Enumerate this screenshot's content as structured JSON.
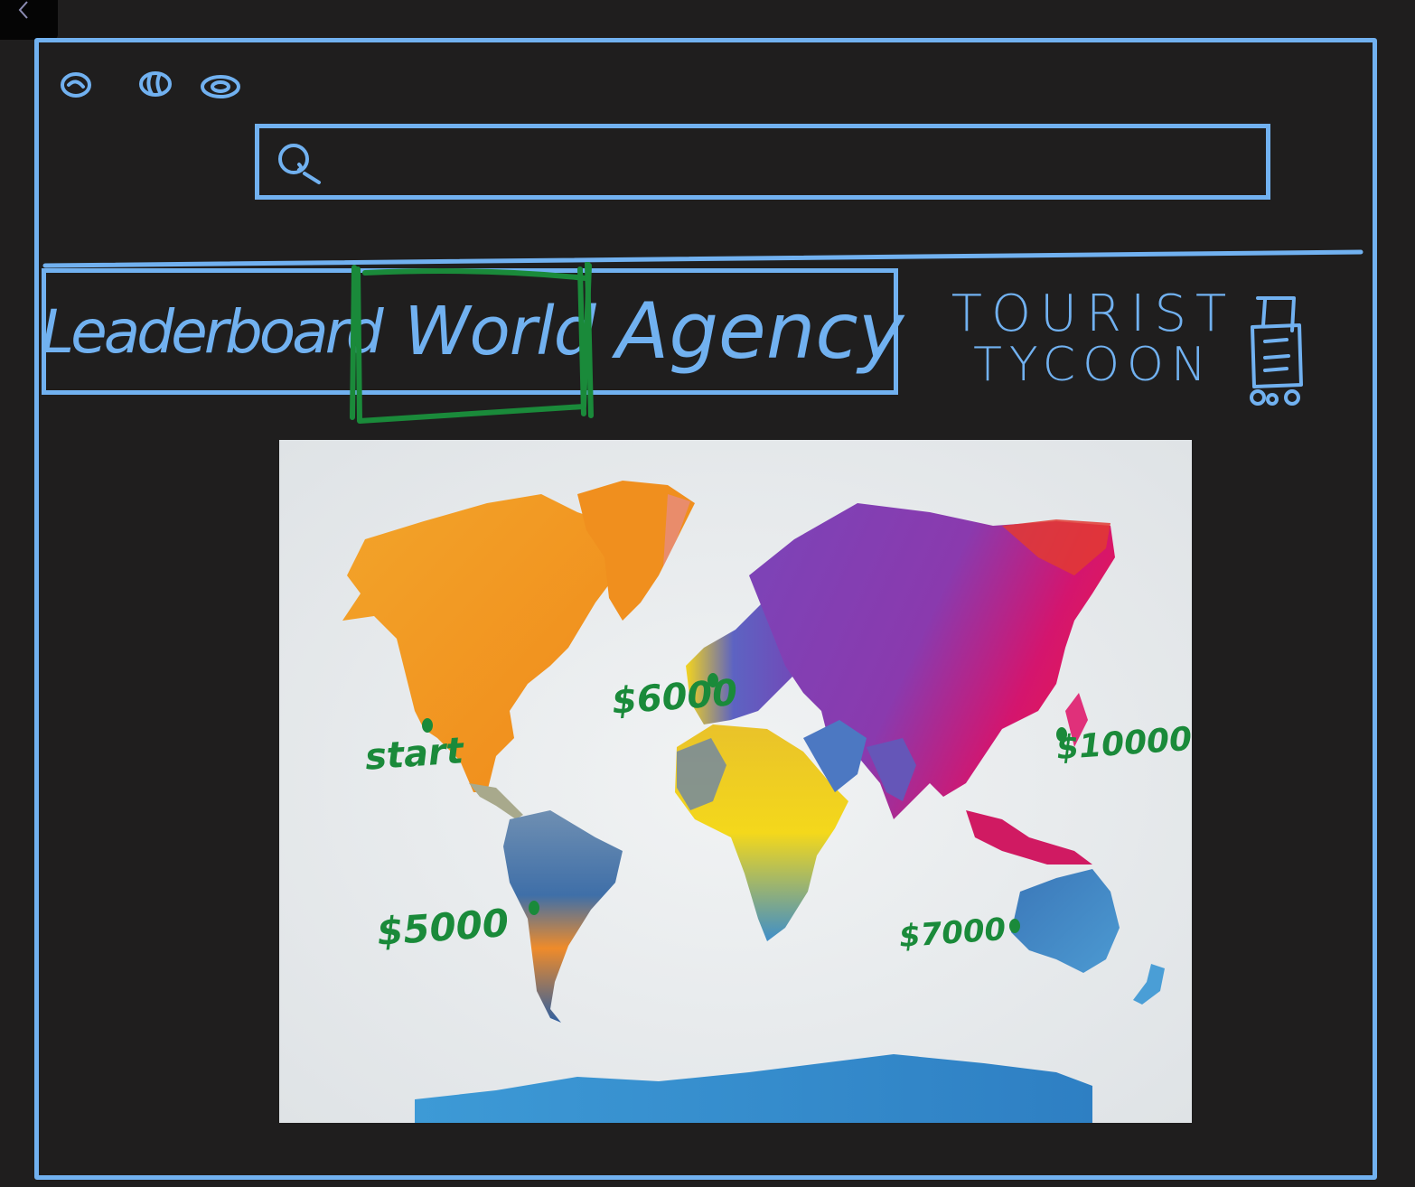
{
  "header": {
    "search": {
      "value": "",
      "placeholder": ""
    }
  },
  "tabs": [
    {
      "label": "Leaderboard",
      "active": false
    },
    {
      "label": "World",
      "active": true
    },
    {
      "label": "Agency",
      "active": false
    }
  ],
  "brand": {
    "line1": "TOURIST",
    "line2": "TYCOON",
    "icon": "luggage-cart-icon"
  },
  "map": {
    "pins": [
      {
        "label": "start"
      },
      {
        "label": "$6000"
      },
      {
        "label": "$10000"
      },
      {
        "label": "$5000"
      },
      {
        "label": "$7000"
      }
    ]
  },
  "colors": {
    "wireframe": "#71b1f0",
    "annotation": "#1a8a3a",
    "background": "#1f1e1e"
  }
}
